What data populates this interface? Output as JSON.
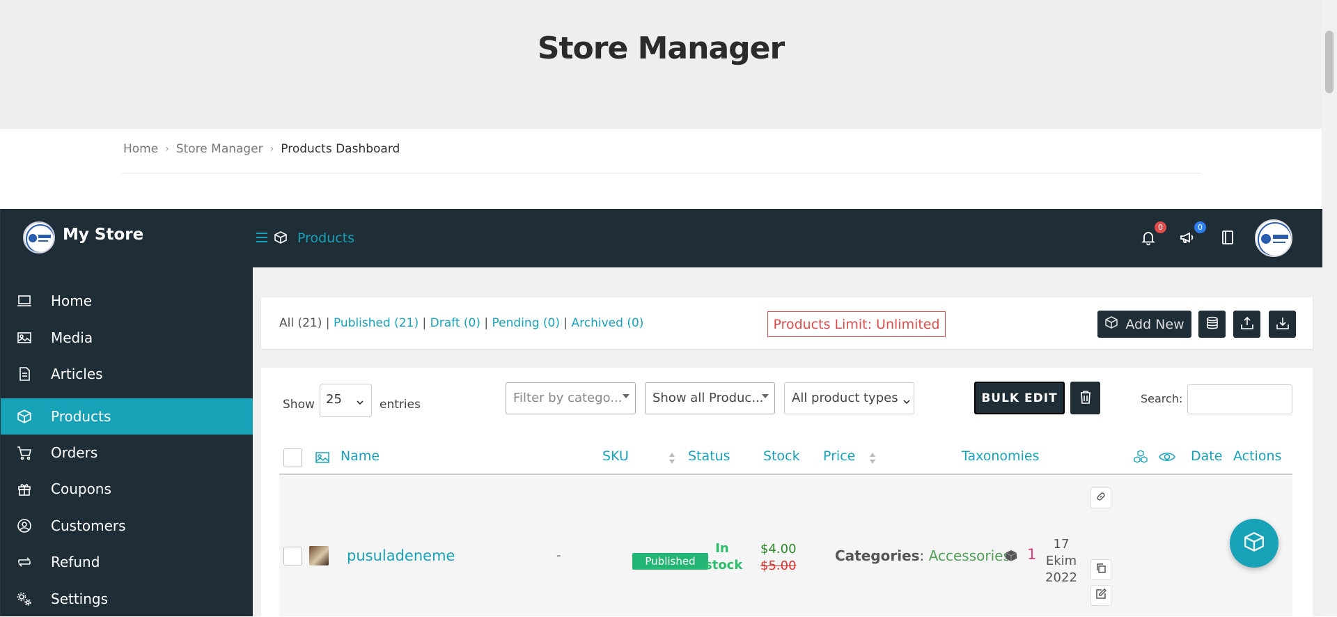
{
  "page": {
    "title": "Store Manager"
  },
  "breadcrumb": {
    "home": "Home",
    "store_manager": "Store Manager",
    "current": "Products Dashboard"
  },
  "header": {
    "store_name": "My Store",
    "section_title": "Products",
    "notifications_count": "0",
    "announcements_count": "0",
    "icons": [
      "menu-icon",
      "cube-icon",
      "bell-icon",
      "megaphone-icon",
      "book-icon"
    ]
  },
  "sidebar": {
    "items": [
      {
        "label": "Home",
        "icon": "laptop-icon",
        "active": false
      },
      {
        "label": "Media",
        "icon": "image-icon",
        "active": false
      },
      {
        "label": "Articles",
        "icon": "document-icon",
        "active": false
      },
      {
        "label": "Products",
        "icon": "cube-icon",
        "active": true
      },
      {
        "label": "Orders",
        "icon": "cart-icon",
        "active": false
      },
      {
        "label": "Coupons",
        "icon": "gift-icon",
        "active": false
      },
      {
        "label": "Customers",
        "icon": "user-circle-icon",
        "active": false
      },
      {
        "label": "Refund",
        "icon": "refund-icon",
        "active": false
      },
      {
        "label": "Settings",
        "icon": "gears-icon",
        "active": false
      }
    ]
  },
  "filters": {
    "all": "All (21)",
    "published": "Published (21)",
    "draft": "Draft (0)",
    "pending": "Pending (0)",
    "archived": "Archived (0)",
    "separator": "|"
  },
  "products_limit": "Products Limit: Unlimited",
  "add_new_label": "Add New",
  "table_controls": {
    "show_label": "Show",
    "page_length": "25",
    "entries_label": "entries",
    "category_filter_placeholder": "Filter by catego...",
    "product_filter": "Show all Produc...",
    "product_type": "All product types",
    "bulk_edit_label": "BULK EDIT",
    "search_label": "Search:"
  },
  "table": {
    "headers": {
      "name": "Name",
      "sku": "SKU",
      "status": "Status",
      "stock": "Stock",
      "price": "Price",
      "taxonomies": "Taxonomies",
      "date": "Date",
      "actions": "Actions"
    },
    "rows": [
      {
        "name": "pusuladeneme",
        "sku": "-",
        "status": "Published",
        "stock_line1": "In",
        "stock_line2": "stock",
        "price_new": "$4.00",
        "price_old": "$5.00",
        "tax_label": "Categories",
        "tax_colon": ":",
        "tax_value": "Accessories",
        "views": "1",
        "date_day": "17",
        "date_month": "Ekim",
        "date_year": "2022"
      }
    ]
  },
  "colors": {
    "accent": "#17a2b8",
    "dark": "#1f2d37",
    "danger": "#e04b4b",
    "published": "#22b573",
    "in_stock": "#2dbe6c"
  }
}
